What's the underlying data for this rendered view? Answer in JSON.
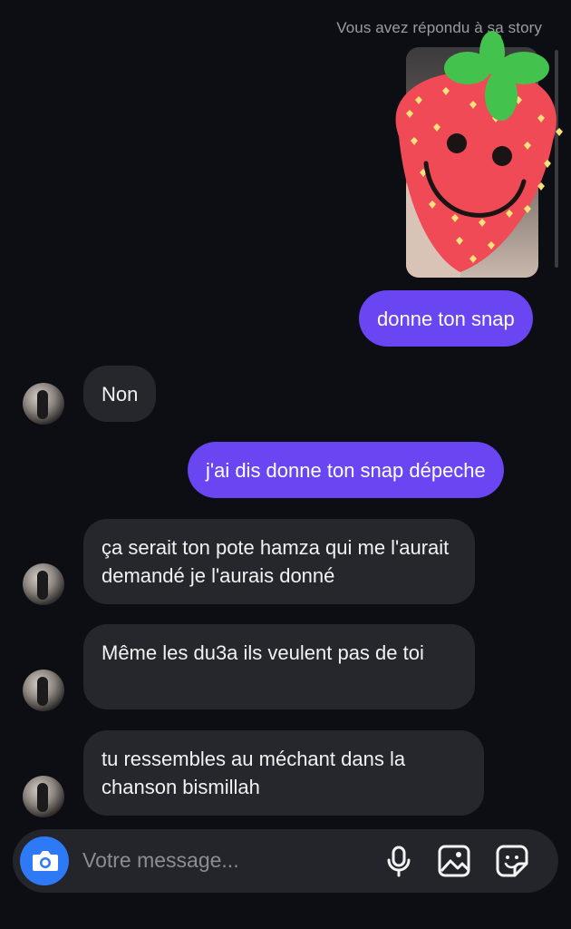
{
  "story_reply": {
    "label": "Vous avez répondu à sa story",
    "sticker_icon": "strawberry-face-sticker"
  },
  "messages": [
    {
      "direction": "out",
      "text": "donne ton snap"
    },
    {
      "direction": "in",
      "text": "Non"
    },
    {
      "direction": "out",
      "text": "j'ai dis donne ton snap dépeche"
    },
    {
      "direction": "in",
      "text": "ça serait ton pote hamza qui me l'aurait demandé je l'aurais donné"
    },
    {
      "direction": "in",
      "text": "Même les du3a ils veulent pas de toi"
    },
    {
      "direction": "in",
      "text": "tu ressembles au méchant dans la chanson bismillah"
    }
  ],
  "composer": {
    "placeholder": "Votre message...",
    "icons": [
      "camera-icon",
      "microphone-icon",
      "image-icon",
      "sticker-icon"
    ]
  },
  "colors": {
    "background": "#0d0e14",
    "outgoing_bubble": "#6a45f2",
    "incoming_bubble": "#26272d",
    "camera_button": "#2d79f6"
  }
}
